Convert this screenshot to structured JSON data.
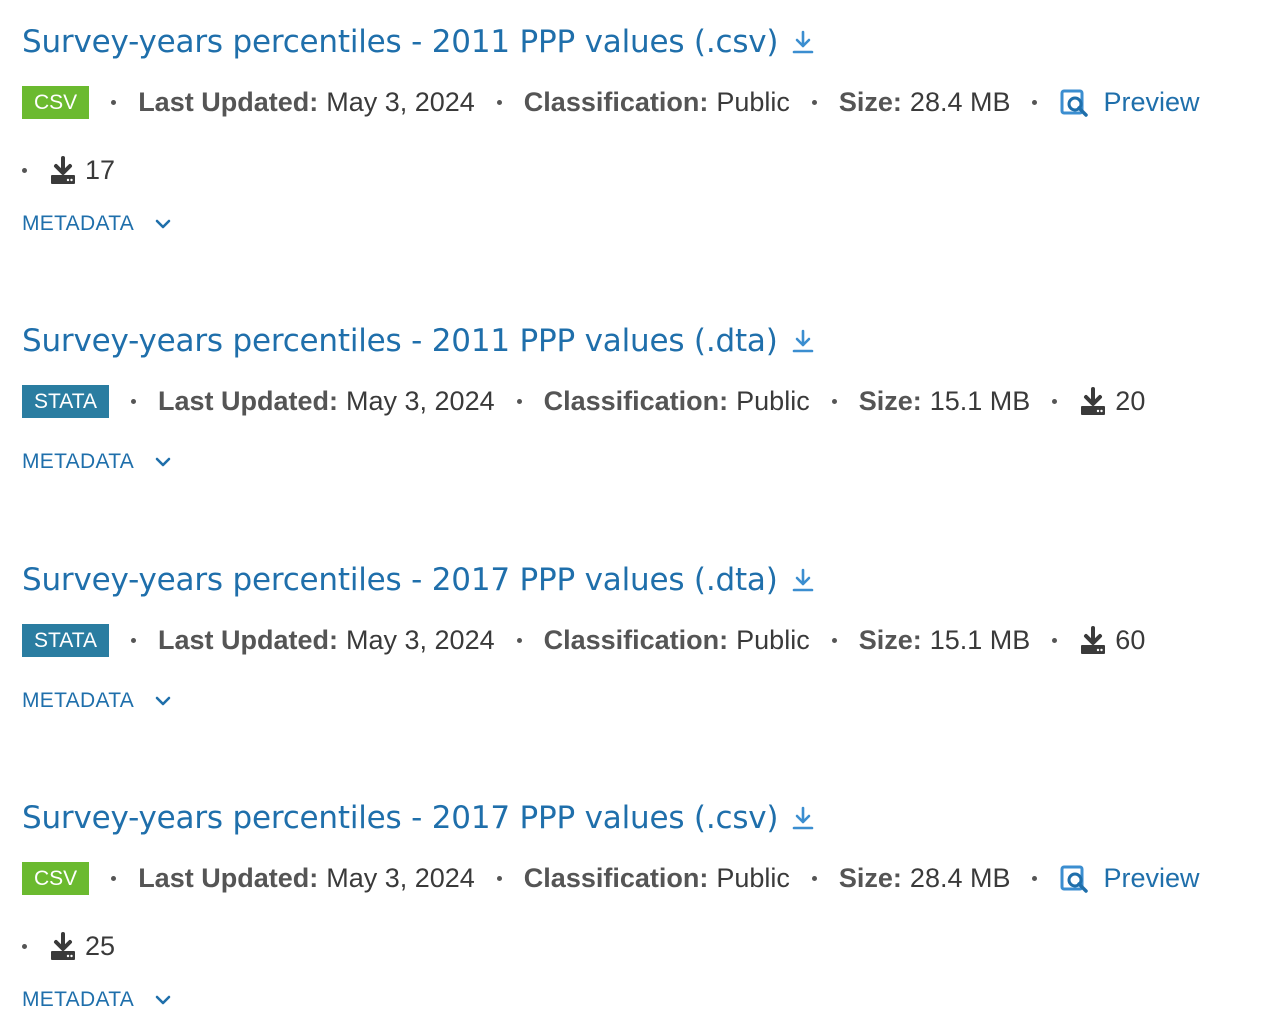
{
  "resources": [
    {
      "title": "Survey-years percentiles - 2011 PPP values (.csv)",
      "format": "CSV",
      "last_updated_label": "Last Updated:",
      "last_updated": "May 3, 2024",
      "classification_label": "Classification:",
      "classification": "Public",
      "size_label": "Size:",
      "size": "28.4 MB",
      "preview_label": "Preview",
      "downloads": "17",
      "metadata_label": "METADATA"
    },
    {
      "title": "Survey-years percentiles - 2011 PPP values (.dta)",
      "format": "STATA",
      "last_updated_label": "Last Updated:",
      "last_updated": "May 3, 2024",
      "classification_label": "Classification:",
      "classification": "Public",
      "size_label": "Size:",
      "size": "15.1 MB",
      "downloads": "20",
      "metadata_label": "METADATA"
    },
    {
      "title": "Survey-years percentiles - 2017 PPP values (.dta)",
      "format": "STATA",
      "last_updated_label": "Last Updated:",
      "last_updated": "May 3, 2024",
      "classification_label": "Classification:",
      "classification": "Public",
      "size_label": "Size:",
      "size": "15.1 MB",
      "downloads": "60",
      "metadata_label": "METADATA"
    },
    {
      "title": "Survey-years percentiles - 2017 PPP values (.csv)",
      "format": "CSV",
      "last_updated_label": "Last Updated:",
      "last_updated": "May 3, 2024",
      "classification_label": "Classification:",
      "classification": "Public",
      "size_label": "Size:",
      "size": "28.4 MB",
      "preview_label": "Preview",
      "downloads": "25",
      "metadata_label": "METADATA"
    }
  ],
  "colors": {
    "link": "#1f6fab",
    "csv_badge": "#6bba2f",
    "stata_badge": "#2a7da1",
    "text": "#3a3a3a"
  },
  "icons": {
    "title_download": "download-arrow-icon",
    "download_count": "download-tray-icon",
    "preview": "preview-magnifier-icon",
    "expand": "chevron-down-icon"
  }
}
